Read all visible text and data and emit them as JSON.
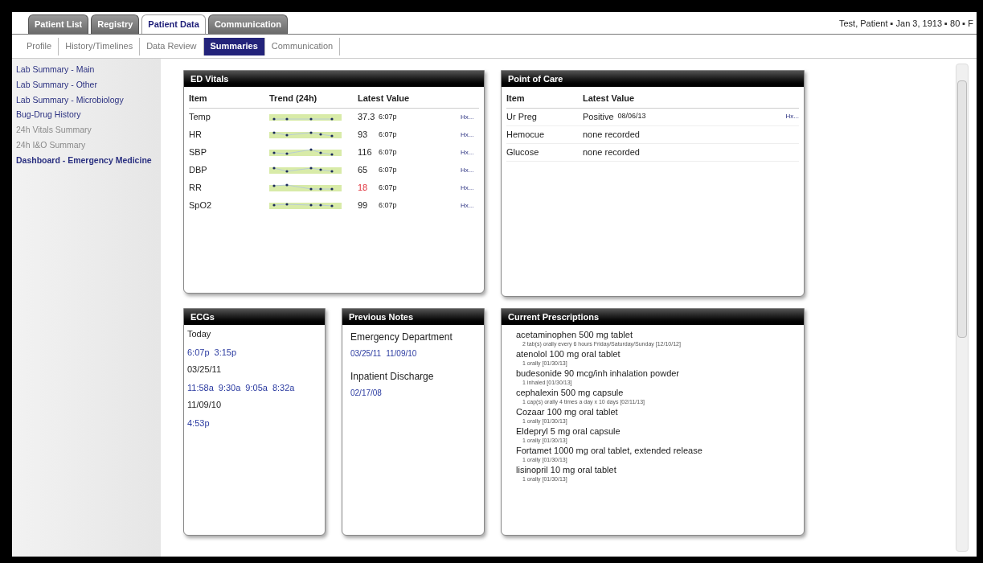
{
  "main_tabs": [
    {
      "label": "Patient List",
      "selected": false
    },
    {
      "label": "Registry",
      "selected": false
    },
    {
      "label": "Patient Data",
      "selected": true
    },
    {
      "label": "Communication",
      "selected": false
    }
  ],
  "patient_banner": "Test, Patient ▪ Jan 3, 1913 ▪ 80 ▪ F",
  "sub_tabs": [
    {
      "label": "Profile",
      "selected": false
    },
    {
      "label": "History/Timelines",
      "selected": false
    },
    {
      "label": "Data Review",
      "selected": false
    },
    {
      "label": "Summaries",
      "selected": true
    },
    {
      "label": "Communication",
      "selected": false
    }
  ],
  "sidebar": {
    "items": [
      {
        "label": "Lab Summary - Main",
        "disabled": false,
        "selected": false
      },
      {
        "label": "Lab Summary - Other",
        "disabled": false,
        "selected": false
      },
      {
        "label": "Lab Summary - Microbiology",
        "disabled": false,
        "selected": false
      },
      {
        "label": "Bug-Drug History",
        "disabled": false,
        "selected": false
      },
      {
        "label": "24h Vitals Summary",
        "disabled": true,
        "selected": false
      },
      {
        "label": "24h I&O Summary",
        "disabled": true,
        "selected": false
      },
      {
        "label": "Dashboard - Emergency Medicine",
        "disabled": false,
        "selected": true
      }
    ]
  },
  "ed_vitals": {
    "title": "ED Vitals",
    "columns": [
      "Item",
      "Trend (24h)",
      "Latest Value"
    ],
    "rows": [
      {
        "item": "Temp",
        "value": "37.3",
        "time": "6:07p",
        "abnormal": false,
        "link": "Hx..."
      },
      {
        "item": "HR",
        "value": "93",
        "time": "6:07p",
        "abnormal": false,
        "link": "Hx..."
      },
      {
        "item": "SBP",
        "value": "116",
        "time": "6:07p",
        "abnormal": false,
        "link": "Hx..."
      },
      {
        "item": "DBP",
        "value": "65",
        "time": "6:07p",
        "abnormal": false,
        "link": "Hx..."
      },
      {
        "item": "RR",
        "value": "18",
        "time": "6:07p",
        "abnormal": true,
        "link": "Hx..."
      },
      {
        "item": "SpO2",
        "value": "99",
        "time": "6:07p",
        "abnormal": false,
        "link": "Hx..."
      }
    ]
  },
  "point_of_care": {
    "title": "Point of Care",
    "columns": [
      "Item",
      "Latest Value"
    ],
    "rows": [
      {
        "item": "Ur Preg",
        "value": "Positive",
        "date": "08/06/13",
        "link": "Hx..."
      },
      {
        "item": "Hemocue",
        "value": "none recorded"
      },
      {
        "item": "Glucose",
        "value": "none recorded"
      }
    ]
  },
  "ecgs": {
    "title": "ECGs",
    "groups": [
      {
        "date": "Today",
        "times": [
          "6:07p",
          "3:15p"
        ]
      },
      {
        "date": "03/25/11",
        "times": [
          "11:58a",
          "9:30a",
          "9:05a",
          "8:32a"
        ]
      },
      {
        "date": "11/09/10",
        "times": [
          "4:53p"
        ]
      }
    ]
  },
  "previous_notes": {
    "title": "Previous Notes",
    "groups": [
      {
        "heading": "Emergency Department",
        "dates": [
          "03/25/11",
          "11/09/10"
        ]
      },
      {
        "heading": "Inpatient Discharge",
        "dates": [
          "02/17/08"
        ]
      }
    ]
  },
  "current_prescriptions": {
    "title": "Current Prescriptions",
    "items": [
      {
        "name": "acetaminophen 500 mg tablet",
        "sig": "2 tab(s) orally every 6 hours Friday/Saturday/Sunday [12/10/12]"
      },
      {
        "name": "atenolol 100 mg oral tablet",
        "sig": "1 orally [01/30/13]"
      },
      {
        "name": "budesonide 90 mcg/inh inhalation powder",
        "sig": "1 inhaled [01/30/13]"
      },
      {
        "name": "cephalexin 500 mg capsule",
        "sig": "1 cap(s) orally 4 times a day x 10 days [02/11/13]"
      },
      {
        "name": "Cozaar 100 mg oral tablet",
        "sig": "1 orally [01/30/13]"
      },
      {
        "name": "Eldepryl 5 mg oral capsule",
        "sig": "1 orally [01/30/13]"
      },
      {
        "name": "Fortamet 1000 mg oral tablet, extended release",
        "sig": "1 orally [01/30/13]"
      },
      {
        "name": "lisinopril 10 mg oral tablet",
        "sig": "1 orally [01/30/13]"
      }
    ]
  }
}
